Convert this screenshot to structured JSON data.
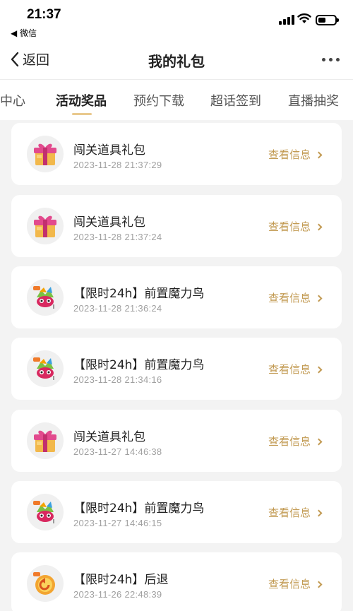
{
  "status_bar": {
    "time": "21:37",
    "back_app": "◀ 微信"
  },
  "nav": {
    "back_label": "返回",
    "title": "我的礼包"
  },
  "tabs": [
    {
      "label": "礼中心",
      "active": false
    },
    {
      "label": "活动奖品",
      "active": true
    },
    {
      "label": "预约下载",
      "active": false
    },
    {
      "label": "超话签到",
      "active": false
    },
    {
      "label": "直播抽奖",
      "active": false
    }
  ],
  "colors": {
    "accent": "#c29a52",
    "tab_underline": "#e9c98e",
    "background": "#f3f3f3"
  },
  "gifts": [
    {
      "title": "闯关道具礼包",
      "time": "2023-11-28 21:37:29",
      "icon": "gift-box-icon",
      "action": "查看信息"
    },
    {
      "title": "闯关道具礼包",
      "time": "2023-11-28 21:37:24",
      "icon": "gift-box-icon",
      "action": "查看信息"
    },
    {
      "title": "【限时24h】前置魔力鸟",
      "time": "2023-11-28 21:36:24",
      "icon": "magic-bird-icon",
      "action": "查看信息"
    },
    {
      "title": "【限时24h】前置魔力鸟",
      "time": "2023-11-28 21:34:16",
      "icon": "magic-bird-icon",
      "action": "查看信息"
    },
    {
      "title": "闯关道具礼包",
      "time": "2023-11-27 14:46:38",
      "icon": "gift-box-icon",
      "action": "查看信息"
    },
    {
      "title": "【限时24h】前置魔力鸟",
      "time": "2023-11-27 14:46:15",
      "icon": "magic-bird-icon",
      "action": "查看信息"
    },
    {
      "title": "【限时24h】后退",
      "time": "2023-11-26 22:48:39",
      "icon": "undo-icon",
      "action": "查看信息"
    }
  ]
}
